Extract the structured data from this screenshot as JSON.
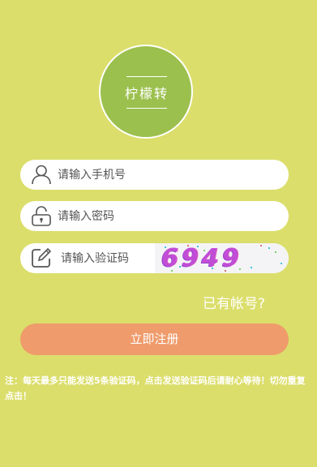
{
  "logo": {
    "text": "柠檬转"
  },
  "form": {
    "phone_placeholder": "请输入手机号",
    "password_placeholder": "请输入密码",
    "code_placeholder": "请输入验证码",
    "captcha_text": "6949"
  },
  "links": {
    "have_account": "已有帐号?"
  },
  "buttons": {
    "register_label": "立即注册"
  },
  "notice": "注：每天最多只能发送5条验证码，点击发送验证码后请耐心等待！切勿重复点击！",
  "colors": {
    "background": "#dbde6b",
    "logo_circle": "#9cc04e",
    "register_button": "#ef9b6b",
    "captcha_glyphs": "#c14dd6"
  },
  "icons": {
    "phone_field": "user-icon",
    "password_field": "lock-icon",
    "code_field": "edit-icon"
  }
}
